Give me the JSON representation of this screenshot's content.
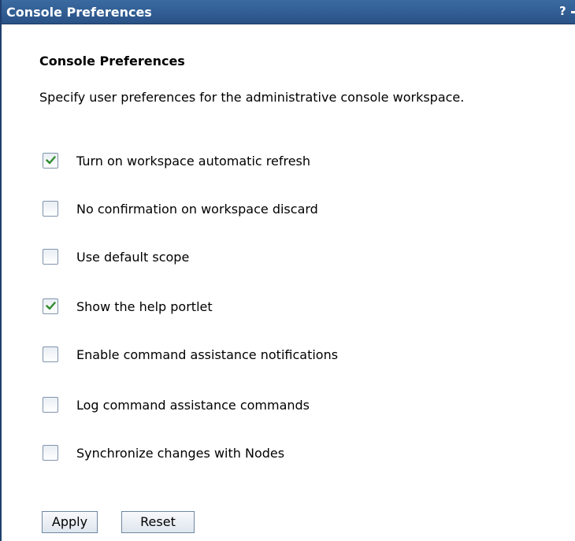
{
  "window": {
    "title": "Console Preferences",
    "help_label": "?"
  },
  "content": {
    "heading": "Console Preferences",
    "description": "Specify user preferences for the administrative console workspace."
  },
  "options": [
    {
      "label": "Turn on workspace automatic refresh",
      "checked": true
    },
    {
      "label": "No confirmation on workspace discard",
      "checked": false
    },
    {
      "label": "Use default scope",
      "checked": false
    },
    {
      "label": "Show the help portlet",
      "checked": true
    },
    {
      "label": "Enable command assistance notifications",
      "checked": false
    },
    {
      "label": "Log command assistance commands",
      "checked": false
    },
    {
      "label": "Synchronize changes with Nodes",
      "checked": false
    }
  ],
  "buttons": {
    "apply": "Apply",
    "reset": "Reset"
  },
  "colors": {
    "titlebar": "#2d5a8e",
    "check": "#2e8b2e"
  }
}
